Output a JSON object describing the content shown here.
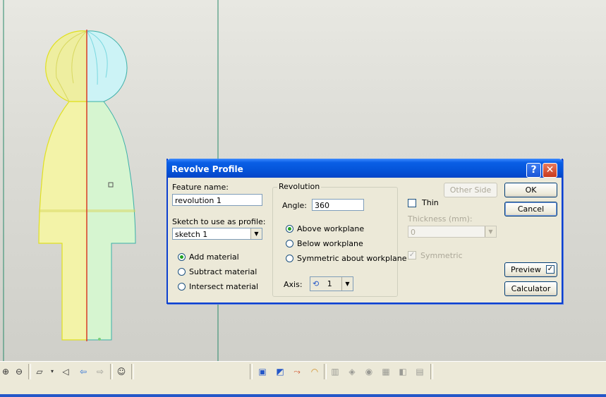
{
  "dialog": {
    "title": "Revolve Profile",
    "help_glyph": "?",
    "close_glyph": "✕",
    "feature_name_label": "Feature name:",
    "feature_name_value": "revolution 1",
    "sketch_label": "Sketch to use as profile:",
    "sketch_value": "sketch 1",
    "material_options": [
      {
        "label": "Add material",
        "selected": true
      },
      {
        "label": "Subtract material",
        "selected": false
      },
      {
        "label": "Intersect material",
        "selected": false
      }
    ],
    "revolution": {
      "group_title": "Revolution",
      "angle_label": "Angle:",
      "angle_value": "360",
      "workplane_options": [
        {
          "label": "Above workplane",
          "selected": true
        },
        {
          "label": "Below workplane",
          "selected": false
        },
        {
          "label": "Symmetric about workplane",
          "selected": false
        }
      ],
      "axis_label": "Axis:",
      "axis_value": "1"
    },
    "thin_label": "Thin",
    "thin_checked": false,
    "other_side_label": "Other Side",
    "thickness_label": "Thickness (mm):",
    "thickness_value": "0",
    "symmetric_label": "Symmetric",
    "symmetric_checked": true,
    "ok_label": "OK",
    "cancel_label": "Cancel",
    "preview_label": "Preview",
    "preview_checked": true,
    "calculator_label": "Calculator"
  },
  "toolbar": {
    "icons": [
      "zoom-in-icon",
      "zoom-out-icon",
      "workplane-icon",
      "view-angle-icon",
      "back-arrow-icon",
      "forward-arrow-icon",
      "smiley-icon",
      "extrude-icon",
      "revolve-icon",
      "sweep-icon",
      "loft-icon",
      "shell-icon",
      "fillet-icon",
      "chamfer-icon",
      "hole-icon",
      "draft-icon",
      "thread-icon"
    ]
  },
  "colors": {
    "accent": "#0554d9",
    "profile_fill": "#f3f3a8",
    "revolved_fill": "#d6f5d0",
    "axis_line": "#d82020"
  }
}
